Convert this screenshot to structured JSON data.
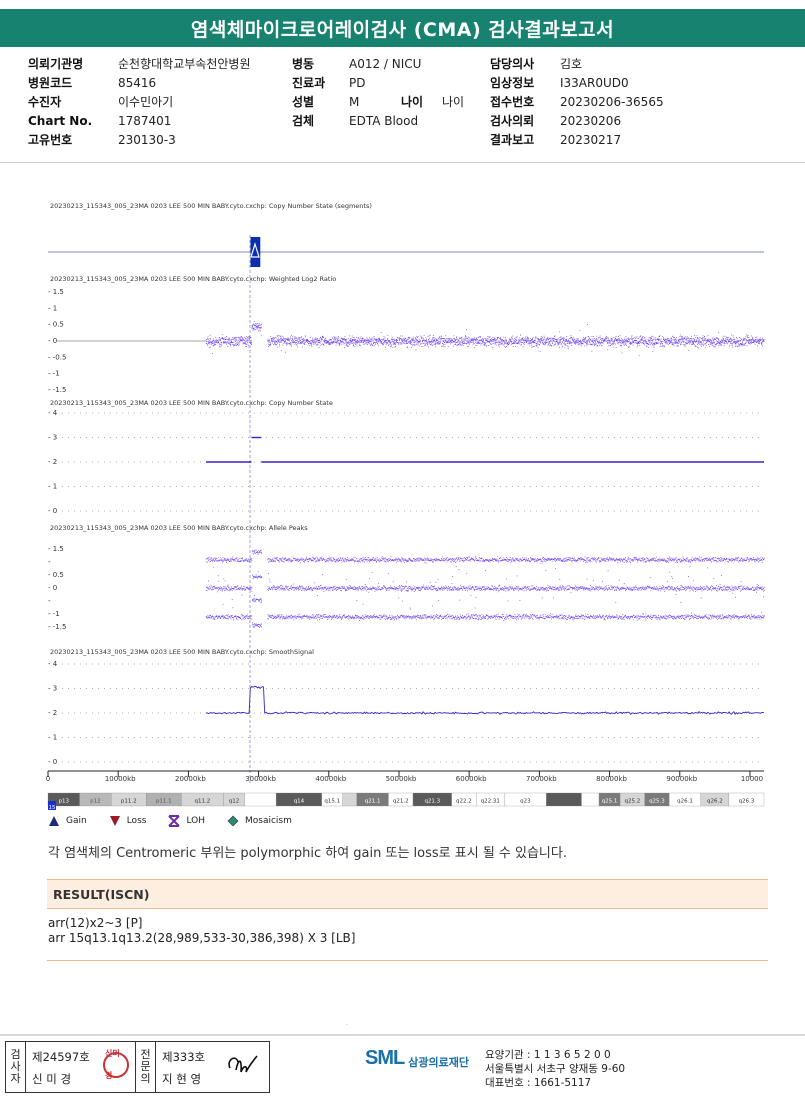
{
  "report": {
    "title": "염색체마이크로어레이검사 (CMA) 검사결과보고서"
  },
  "patient_info": {
    "col1": [
      {
        "label": "의뢰기관명",
        "value": "순천향대학교부속천안병원"
      },
      {
        "label": "병원코드",
        "value": "85416"
      },
      {
        "label": "수진자",
        "value": "이수민아기"
      },
      {
        "label": "Chart No.",
        "value": "1787401"
      },
      {
        "label": "고유번호",
        "value": "230130-3"
      }
    ],
    "col2": [
      {
        "label": "병동",
        "value": "A012 / NICU"
      },
      {
        "label": "진료과",
        "value": "PD"
      },
      {
        "label": "성별",
        "value": "M",
        "extra_label": "나이",
        "extra_value": "나이"
      },
      {
        "label": "검체",
        "value": "EDTA Blood"
      }
    ],
    "col3": [
      {
        "label": "담당의사",
        "value": "김호"
      },
      {
        "label": "임상정보",
        "value": "I33AR0UD0"
      },
      {
        "label": "접수번호",
        "value": "20230206-36565"
      },
      {
        "label": "검사의뢰",
        "value": "20230206"
      },
      {
        "label": "결과보고",
        "value": "20230217"
      }
    ]
  },
  "tracks": {
    "copy_number_segments": "20230213_115343_005_23MA 0203 LEE 500 MIN BABY.cyto.cxchp: Copy Number State (segments)",
    "log2_ratio": "20230213_115343_005_23MA 0203 LEE 500 MIN BABY.cyto.cxchp: Weighted Log2 Ratio",
    "copy_number_state": "20230213_115343_005_23MA 0203 LEE 500 MIN BABY.cyto.cxchp: Copy Number State",
    "allele_peaks": "20230213_115343_005_23MA 0203 LEE 500 MIN BABY.cyto.cxchp: Allele Peaks",
    "smooth_signal": "20230213_115343_005_23MA 0203 LEE 500 MIN BABY.cyto.cxchp: SmoothSignal"
  },
  "chart_data": {
    "type": "line",
    "chromosome": "15",
    "x_unit": "kb",
    "x_range": [
      0,
      100000
    ],
    "x_ticks": [
      "0",
      "10000kb",
      "20000kb",
      "30000kb",
      "40000kb",
      "50000kb",
      "60000kb",
      "70000kb",
      "80000kb",
      "90000kb",
      "10000"
    ],
    "data_start_kb": 22500,
    "gain_region_kb": [
      28990,
      30386
    ],
    "log2_ticks": [
      "1.5",
      "1",
      "0.5",
      "0",
      "-0.5",
      "-1",
      "-1.5"
    ],
    "copy_number_ticks": [
      "4",
      "3",
      "2",
      "1",
      "0"
    ],
    "allele_peak_ticks": [
      "1.5",
      "",
      "0.5",
      "0",
      "",
      "-1",
      "-1.5"
    ],
    "smooth_ticks": [
      "4",
      "3",
      "2",
      "1",
      "0"
    ],
    "copy_number_values": [
      {
        "x_start": 22500,
        "x_end": 28990,
        "value": 2
      },
      {
        "x_start": 28990,
        "x_end": 30386,
        "value": 3
      },
      {
        "x_start": 30386,
        "x_end": 102000,
        "value": 2
      }
    ],
    "bands": [
      {
        "label": "p13",
        "start": 0,
        "end": 4500,
        "color": "#5a5a5a",
        "text": "#ffffff"
      },
      {
        "label": "p12",
        "start": 4500,
        "end": 9000,
        "color": "#b8b8b8",
        "text": "#555555"
      },
      {
        "label": "p11.2",
        "start": 9000,
        "end": 14000,
        "color": "#d6d6d6",
        "text": "#333333"
      },
      {
        "label": "p11.1",
        "start": 14000,
        "end": 19000,
        "color": "#b0b0b0",
        "text": "#555555"
      },
      {
        "label": "q11.2",
        "start": 19000,
        "end": 25000,
        "color": "#d6d6d6",
        "text": "#333333"
      },
      {
        "label": "q12",
        "start": 25000,
        "end": 28000,
        "color": "#d6d6d6",
        "text": "#333333"
      },
      {
        "label": "",
        "start": 28000,
        "end": 32500,
        "color": "#ffffff",
        "text": "#333333"
      },
      {
        "label": "q14",
        "start": 32500,
        "end": 39000,
        "color": "#5a5a5a",
        "text": "#ffffff"
      },
      {
        "label": "q15.1",
        "start": 39000,
        "end": 42000,
        "color": "#ffffff",
        "text": "#333333"
      },
      {
        "label": "",
        "start": 42000,
        "end": 44000,
        "color": "#d6d6d6",
        "text": "#333333"
      },
      {
        "label": "q21.1",
        "start": 44000,
        "end": 48500,
        "color": "#7a7a7a",
        "text": "#ffffff"
      },
      {
        "label": "q21.2",
        "start": 48500,
        "end": 52000,
        "color": "#ffffff",
        "text": "#333333"
      },
      {
        "label": "q21.3",
        "start": 52000,
        "end": 57500,
        "color": "#5a5a5a",
        "text": "#ffffff"
      },
      {
        "label": "q22.2",
        "start": 57500,
        "end": 61000,
        "color": "#ffffff",
        "text": "#333333"
      },
      {
        "label": "q22.31",
        "start": 61000,
        "end": 65000,
        "color": "#ffffff",
        "text": "#333333"
      },
      {
        "label": "q23",
        "start": 65000,
        "end": 71000,
        "color": "#ffffff",
        "text": "#333333"
      },
      {
        "label": "",
        "start": 71000,
        "end": 76000,
        "color": "#5a5a5a",
        "text": "#ffffff"
      },
      {
        "label": "",
        "start": 76000,
        "end": 78500,
        "color": "#ffffff",
        "text": "#333333"
      },
      {
        "label": "q25.1",
        "start": 78500,
        "end": 81500,
        "color": "#7a7a7a",
        "text": "#ffffff"
      },
      {
        "label": "q25.2",
        "start": 81500,
        "end": 85000,
        "color": "#d6d6d6",
        "text": "#333333"
      },
      {
        "label": "q25.3",
        "start": 85000,
        "end": 88500,
        "color": "#7a7a7a",
        "text": "#ffffff"
      },
      {
        "label": "q26.1",
        "start": 88500,
        "end": 93000,
        "color": "#ffffff",
        "text": "#333333"
      },
      {
        "label": "q26.2",
        "start": 93000,
        "end": 97000,
        "color": "#d6d6d6",
        "text": "#333333"
      },
      {
        "label": "q26.3",
        "start": 97000,
        "end": 102000,
        "color": "#ffffff",
        "text": "#333333"
      }
    ],
    "series_color": "#6a3cf0"
  },
  "legend": [
    {
      "label": "Gain",
      "icon": "triangle-up",
      "color": "#1f2b7a"
    },
    {
      "label": "Loss",
      "icon": "triangle-down",
      "color": "#9b1b25"
    },
    {
      "label": "LOH",
      "icon": "x-box",
      "color": "#6a2fa0"
    },
    {
      "label": "Mosaicism",
      "icon": "diamond",
      "color": "#2c8a6e"
    }
  ],
  "note": "각 염색체의 Centromeric 부위는 polymorphic 하여 gain 또는 loss로 표시 될 수 있습니다.",
  "result": {
    "header": "RESULT(ISCN)",
    "line1": "arr(12)x2~3 [P]",
    "line2": "arr 15q13.1q13.2(28,989,533-30,386,398) X 3 [LB]"
  },
  "footer": {
    "examiner_label": "검사자",
    "examiner_license": "제24597호",
    "examiner_name": "신 미 경",
    "examiner_stamp": "신미경",
    "reviewer_label": "전문의",
    "reviewer_license": "제333호",
    "reviewer_name": "지 현 영",
    "logo_mark": "SML",
    "logo_text": "삼광의료재단",
    "org_code": "요양기관 : 1 1 3 6 5 2 0 0",
    "address": "서울특별시 서초구 양재동 9-60",
    "phone": "대표번호 : 1661-5117",
    "dot_mark": "."
  }
}
